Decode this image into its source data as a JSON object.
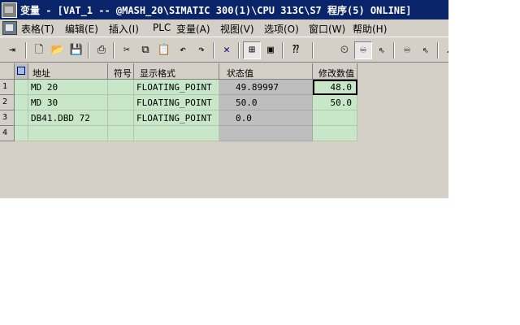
{
  "window": {
    "title": "变量 - [VAT_1 -- @MASH_20\\SIMATIC 300(1)\\CPU 313C\\S7 程序(5)   ONLINE]"
  },
  "menu": [
    "表格(T)",
    "编辑(E)",
    "插入(I)",
    "PLC",
    "变量(A)",
    "视图(V)",
    "选项(O)",
    "窗口(W)",
    "帮助(H)"
  ],
  "toolbar": {
    "icons": [
      "pin-icon",
      "new-icon",
      "open-icon",
      "save-icon",
      "print-icon",
      "cut-icon",
      "copy-icon",
      "paste-icon",
      "undo-icon",
      "redo-icon",
      "delete-icon",
      "network-icon",
      "plc-icon",
      "help-icon",
      "monitor-icon",
      "monitor-active-icon",
      "modify-icon",
      "monitor-once-icon",
      "modify-once-icon",
      "more-icon"
    ]
  },
  "table": {
    "headers": [
      "地址",
      "符号",
      "显示格式",
      "状态值",
      "修改数值"
    ],
    "rows": [
      {
        "num": "1",
        "address": "MD     20",
        "symbol": "",
        "format": "FLOATING_POINT",
        "status": "49.89997",
        "modify": "48.0"
      },
      {
        "num": "2",
        "address": "MD     30",
        "symbol": "",
        "format": "FLOATING_POINT",
        "status": "50.0",
        "modify": "50.0"
      },
      {
        "num": "3",
        "address": "DB41.DBD    72",
        "symbol": "",
        "format": "FLOATING_POINT",
        "status": "0.0",
        "modify": ""
      },
      {
        "num": "4",
        "address": "",
        "symbol": "",
        "format": "",
        "status": "",
        "modify": ""
      }
    ]
  }
}
